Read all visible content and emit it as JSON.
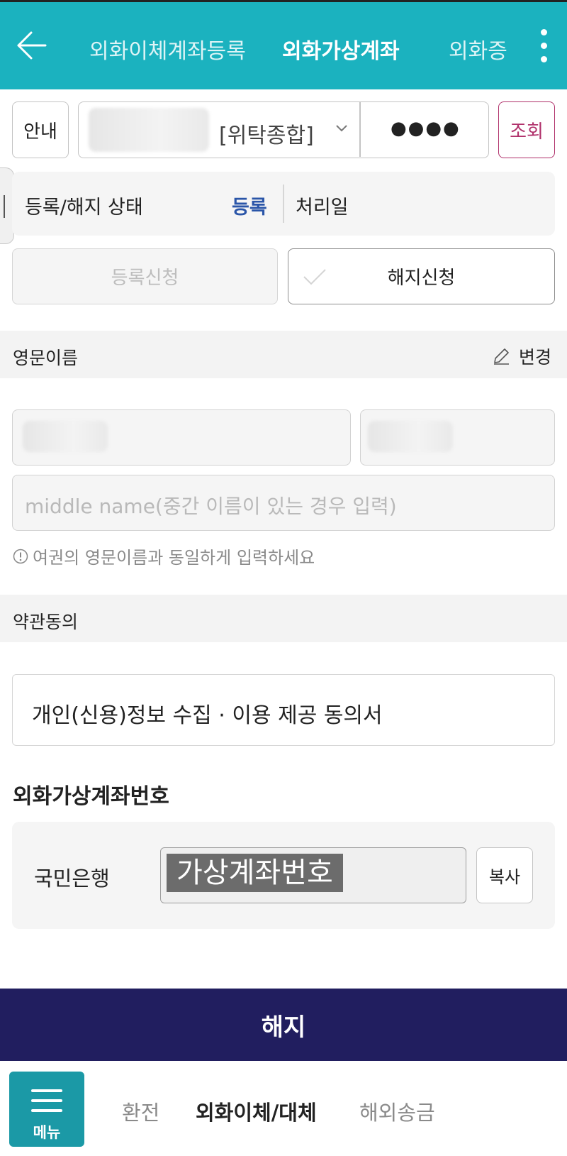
{
  "header": {
    "tabs": [
      {
        "label": "외화이체계좌등록",
        "active": false
      },
      {
        "label": "외화가상계좌",
        "active": true
      },
      {
        "label": "외화증",
        "active": false
      }
    ]
  },
  "account_bar": {
    "guide_label": "안내",
    "account_type": "[위탁종합]",
    "password_mask": "●●●●",
    "lookup_label": "조회"
  },
  "status": {
    "label": "등록/해지 상태",
    "value": "등록",
    "date_label": "처리일"
  },
  "actions": {
    "register_label": "등록신청",
    "cancel_label": "해지신청"
  },
  "english_name": {
    "section_title": "영문이름",
    "edit_label": "변경",
    "middle_name_placeholder": "middle name(중간 이름이 있는 경우 입력)",
    "notice": "여권의 영문이름과 동일하게 입력하세요"
  },
  "terms": {
    "section_title": "약관동의",
    "item_label": "개인(신용)정보 수집 · 이용 제공 동의서"
  },
  "virtual_account": {
    "title": "외화가상계좌번호",
    "bank": "국민은행",
    "number_text": "가상계좌번호",
    "copy_label": "복사"
  },
  "submit_label": "해지",
  "bottom_nav": {
    "menu_label": "메뉴",
    "items": [
      {
        "label": "환전",
        "active": false
      },
      {
        "label": "외화이체/대체",
        "active": true
      },
      {
        "label": "해외송금",
        "active": false
      }
    ]
  },
  "colors": {
    "header_bg": "#1bb2bf",
    "status_value": "#2a55a8",
    "lookup_accent": "#b0316b",
    "submit_bg": "#211e5f",
    "menu_bg": "#1b99a6"
  }
}
